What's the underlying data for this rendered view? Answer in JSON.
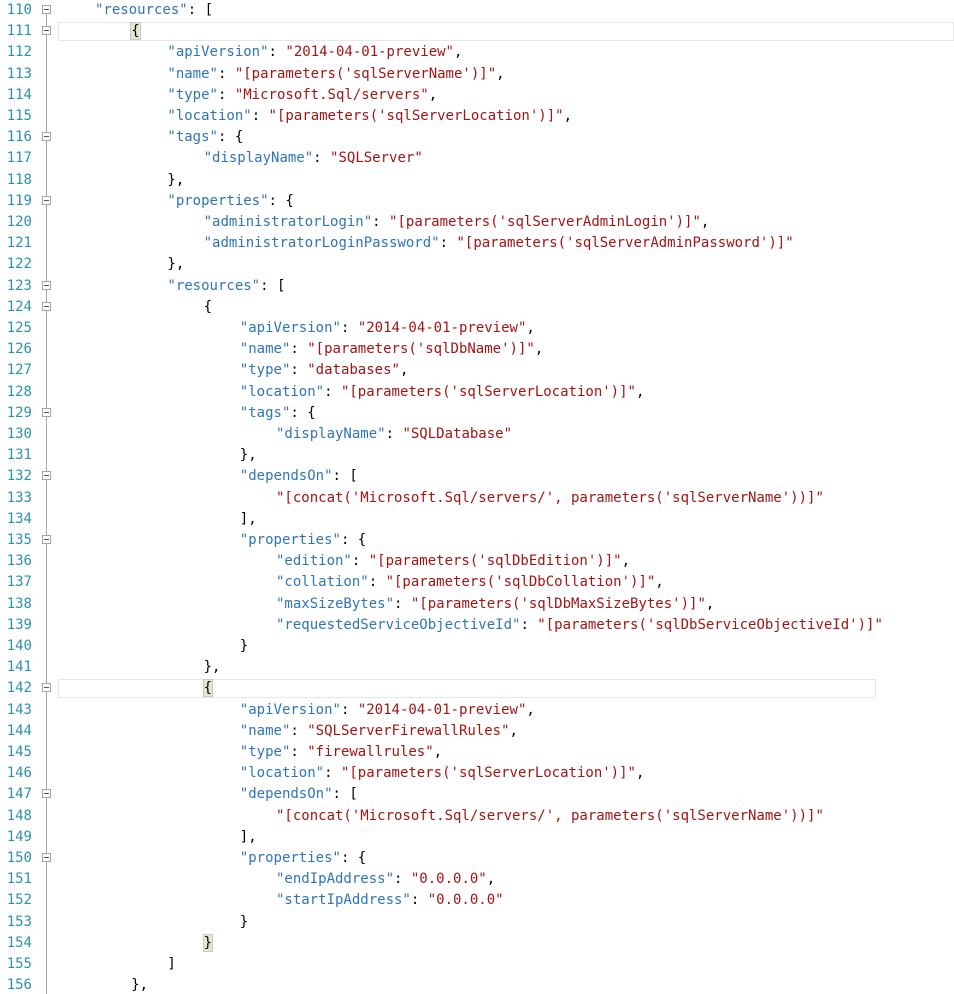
{
  "editor": {
    "lines": [
      {
        "n": "110",
        "fold": true,
        "indent": 1,
        "tokens": [
          [
            "k",
            "\"resources\""
          ],
          [
            "p",
            ": ["
          ]
        ]
      },
      {
        "n": "111",
        "fold": true,
        "indent": 2,
        "tokens": [
          [
            "b",
            "{"
          ]
        ],
        "current": true
      },
      {
        "n": "112",
        "fold": false,
        "indent": 3,
        "tokens": [
          [
            "k",
            "\"apiVersion\""
          ],
          [
            "p",
            ": "
          ],
          [
            "s",
            "\"2014-04-01-preview\""
          ],
          [
            "p",
            ","
          ]
        ]
      },
      {
        "n": "113",
        "fold": false,
        "indent": 3,
        "tokens": [
          [
            "k",
            "\"name\""
          ],
          [
            "p",
            ": "
          ],
          [
            "s",
            "\"[parameters('sqlServerName')]\""
          ],
          [
            "p",
            ","
          ]
        ]
      },
      {
        "n": "114",
        "fold": false,
        "indent": 3,
        "tokens": [
          [
            "k",
            "\"type\""
          ],
          [
            "p",
            ": "
          ],
          [
            "s",
            "\"Microsoft.Sql/servers\""
          ],
          [
            "p",
            ","
          ]
        ]
      },
      {
        "n": "115",
        "fold": false,
        "indent": 3,
        "tokens": [
          [
            "k",
            "\"location\""
          ],
          [
            "p",
            ": "
          ],
          [
            "s",
            "\"[parameters('sqlServerLocation')]\""
          ],
          [
            "p",
            ","
          ]
        ]
      },
      {
        "n": "116",
        "fold": true,
        "indent": 3,
        "tokens": [
          [
            "k",
            "\"tags\""
          ],
          [
            "p",
            ": {"
          ]
        ]
      },
      {
        "n": "117",
        "fold": false,
        "indent": 4,
        "tokens": [
          [
            "k",
            "\"displayName\""
          ],
          [
            "p",
            ": "
          ],
          [
            "s",
            "\"SQLServer\""
          ]
        ]
      },
      {
        "n": "118",
        "fold": false,
        "indent": 3,
        "tokens": [
          [
            "p",
            "},"
          ]
        ]
      },
      {
        "n": "119",
        "fold": true,
        "indent": 3,
        "tokens": [
          [
            "k",
            "\"properties\""
          ],
          [
            "p",
            ": {"
          ]
        ]
      },
      {
        "n": "120",
        "fold": false,
        "indent": 4,
        "tokens": [
          [
            "k",
            "\"administratorLogin\""
          ],
          [
            "p",
            ": "
          ],
          [
            "s",
            "\"[parameters('sqlServerAdminLogin')]\""
          ],
          [
            "p",
            ","
          ]
        ]
      },
      {
        "n": "121",
        "fold": false,
        "indent": 4,
        "tokens": [
          [
            "k",
            "\"administratorLoginPassword\""
          ],
          [
            "p",
            ": "
          ],
          [
            "s",
            "\"[parameters('sqlServerAdminPassword')]\""
          ]
        ]
      },
      {
        "n": "122",
        "fold": false,
        "indent": 3,
        "tokens": [
          [
            "p",
            "},"
          ]
        ]
      },
      {
        "n": "123",
        "fold": true,
        "indent": 3,
        "tokens": [
          [
            "k",
            "\"resources\""
          ],
          [
            "p",
            ": ["
          ]
        ]
      },
      {
        "n": "124",
        "fold": true,
        "indent": 4,
        "tokens": [
          [
            "p",
            "{"
          ]
        ]
      },
      {
        "n": "125",
        "fold": false,
        "indent": 5,
        "tokens": [
          [
            "k",
            "\"apiVersion\""
          ],
          [
            "p",
            ": "
          ],
          [
            "s",
            "\"2014-04-01-preview\""
          ],
          [
            "p",
            ","
          ]
        ]
      },
      {
        "n": "126",
        "fold": false,
        "indent": 5,
        "tokens": [
          [
            "k",
            "\"name\""
          ],
          [
            "p",
            ": "
          ],
          [
            "s",
            "\"[parameters('sqlDbName')]\""
          ],
          [
            "p",
            ","
          ]
        ]
      },
      {
        "n": "127",
        "fold": false,
        "indent": 5,
        "tokens": [
          [
            "k",
            "\"type\""
          ],
          [
            "p",
            ": "
          ],
          [
            "s",
            "\"databases\""
          ],
          [
            "p",
            ","
          ]
        ]
      },
      {
        "n": "128",
        "fold": false,
        "indent": 5,
        "tokens": [
          [
            "k",
            "\"location\""
          ],
          [
            "p",
            ": "
          ],
          [
            "s",
            "\"[parameters('sqlServerLocation')]\""
          ],
          [
            "p",
            ","
          ]
        ]
      },
      {
        "n": "129",
        "fold": true,
        "indent": 5,
        "tokens": [
          [
            "k",
            "\"tags\""
          ],
          [
            "p",
            ": {"
          ]
        ]
      },
      {
        "n": "130",
        "fold": false,
        "indent": 6,
        "tokens": [
          [
            "k",
            "\"displayName\""
          ],
          [
            "p",
            ": "
          ],
          [
            "s",
            "\"SQLDatabase\""
          ]
        ]
      },
      {
        "n": "131",
        "fold": false,
        "indent": 5,
        "tokens": [
          [
            "p",
            "},"
          ]
        ]
      },
      {
        "n": "132",
        "fold": true,
        "indent": 5,
        "tokens": [
          [
            "k",
            "\"dependsOn\""
          ],
          [
            "p",
            ": ["
          ]
        ]
      },
      {
        "n": "133",
        "fold": false,
        "indent": 6,
        "tokens": [
          [
            "s",
            "\"[concat('Microsoft.Sql/servers/', parameters('sqlServerName'))]\""
          ]
        ]
      },
      {
        "n": "134",
        "fold": false,
        "indent": 5,
        "tokens": [
          [
            "p",
            "],"
          ]
        ]
      },
      {
        "n": "135",
        "fold": true,
        "indent": 5,
        "tokens": [
          [
            "k",
            "\"properties\""
          ],
          [
            "p",
            ": {"
          ]
        ]
      },
      {
        "n": "136",
        "fold": false,
        "indent": 6,
        "tokens": [
          [
            "k",
            "\"edition\""
          ],
          [
            "p",
            ": "
          ],
          [
            "s",
            "\"[parameters('sqlDbEdition')]\""
          ],
          [
            "p",
            ","
          ]
        ]
      },
      {
        "n": "137",
        "fold": false,
        "indent": 6,
        "tokens": [
          [
            "k",
            "\"collation\""
          ],
          [
            "p",
            ": "
          ],
          [
            "s",
            "\"[parameters('sqlDbCollation')]\""
          ],
          [
            "p",
            ","
          ]
        ]
      },
      {
        "n": "138",
        "fold": false,
        "indent": 6,
        "tokens": [
          [
            "k",
            "\"maxSizeBytes\""
          ],
          [
            "p",
            ": "
          ],
          [
            "s",
            "\"[parameters('sqlDbMaxSizeBytes')]\""
          ],
          [
            "p",
            ","
          ]
        ]
      },
      {
        "n": "139",
        "fold": false,
        "indent": 6,
        "tokens": [
          [
            "k",
            "\"requestedServiceObjectiveId\""
          ],
          [
            "p",
            ": "
          ],
          [
            "s",
            "\"[parameters('sqlDbServiceObjectiveId')]\""
          ]
        ]
      },
      {
        "n": "140",
        "fold": false,
        "indent": 5,
        "tokens": [
          [
            "p",
            "}"
          ]
        ]
      },
      {
        "n": "141",
        "fold": false,
        "indent": 4,
        "tokens": [
          [
            "p",
            "},"
          ]
        ]
      },
      {
        "n": "142",
        "fold": true,
        "indent": 4,
        "tokens": [
          [
            "b",
            "{"
          ]
        ],
        "current2": true
      },
      {
        "n": "143",
        "fold": false,
        "indent": 5,
        "tokens": [
          [
            "k",
            "\"apiVersion\""
          ],
          [
            "p",
            ": "
          ],
          [
            "s",
            "\"2014-04-01-preview\""
          ],
          [
            "p",
            ","
          ]
        ]
      },
      {
        "n": "144",
        "fold": false,
        "indent": 5,
        "tokens": [
          [
            "k",
            "\"name\""
          ],
          [
            "p",
            ": "
          ],
          [
            "s",
            "\"SQLServerFirewallRules\""
          ],
          [
            "p",
            ","
          ]
        ]
      },
      {
        "n": "145",
        "fold": false,
        "indent": 5,
        "tokens": [
          [
            "k",
            "\"type\""
          ],
          [
            "p",
            ": "
          ],
          [
            "s",
            "\"firewallrules\""
          ],
          [
            "p",
            ","
          ]
        ]
      },
      {
        "n": "146",
        "fold": false,
        "indent": 5,
        "tokens": [
          [
            "k",
            "\"location\""
          ],
          [
            "p",
            ": "
          ],
          [
            "s",
            "\"[parameters('sqlServerLocation')]\""
          ],
          [
            "p",
            ","
          ]
        ]
      },
      {
        "n": "147",
        "fold": true,
        "indent": 5,
        "tokens": [
          [
            "k",
            "\"dependsOn\""
          ],
          [
            "p",
            ": ["
          ]
        ]
      },
      {
        "n": "148",
        "fold": false,
        "indent": 6,
        "tokens": [
          [
            "s",
            "\"[concat('Microsoft.Sql/servers/', parameters('sqlServerName'))]\""
          ]
        ]
      },
      {
        "n": "149",
        "fold": false,
        "indent": 5,
        "tokens": [
          [
            "p",
            "],"
          ]
        ]
      },
      {
        "n": "150",
        "fold": true,
        "indent": 5,
        "tokens": [
          [
            "k",
            "\"properties\""
          ],
          [
            "p",
            ": {"
          ]
        ]
      },
      {
        "n": "151",
        "fold": false,
        "indent": 6,
        "tokens": [
          [
            "k",
            "\"endIpAddress\""
          ],
          [
            "p",
            ": "
          ],
          [
            "s",
            "\"0.0.0.0\""
          ],
          [
            "p",
            ","
          ]
        ]
      },
      {
        "n": "152",
        "fold": false,
        "indent": 6,
        "tokens": [
          [
            "k",
            "\"startIpAddress\""
          ],
          [
            "p",
            ": "
          ],
          [
            "s",
            "\"0.0.0.0\""
          ]
        ]
      },
      {
        "n": "153",
        "fold": false,
        "indent": 5,
        "tokens": [
          [
            "p",
            "}"
          ]
        ]
      },
      {
        "n": "154",
        "fold": false,
        "indent": 4,
        "tokens": [
          [
            "b",
            "}"
          ]
        ]
      },
      {
        "n": "155",
        "fold": false,
        "indent": 3,
        "tokens": [
          [
            "p",
            "]"
          ]
        ]
      },
      {
        "n": "156",
        "fold": false,
        "indent": 2,
        "tokens": [
          [
            "p",
            "},"
          ]
        ]
      }
    ]
  },
  "colors": {
    "line_number": "#2b91af",
    "key": "#2e75b6",
    "string": "#a31515",
    "punctuation": "#000000",
    "brace_highlight": "#e2e6d6"
  }
}
